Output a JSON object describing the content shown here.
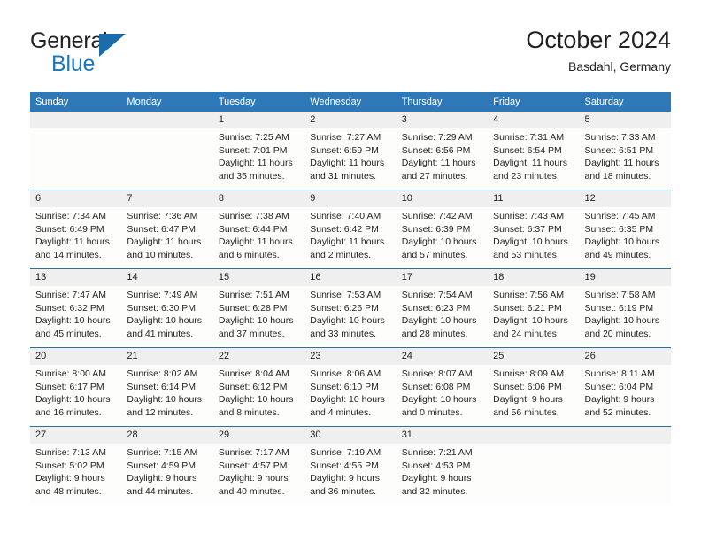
{
  "brand": {
    "line1": "General",
    "line2": "Blue",
    "logo_icon": "blue-triangle-icon",
    "accent_color": "#1b76bc"
  },
  "header": {
    "title": "October 2024",
    "subtitle": "Basdahl, Germany"
  },
  "theme": {
    "header_blue": "#2e78b7",
    "week_rule": "#2e6f9e",
    "daynum_band": "#efefef",
    "text": "#231f20"
  },
  "calendar": {
    "weekdays": [
      "Sunday",
      "Monday",
      "Tuesday",
      "Wednesday",
      "Thursday",
      "Friday",
      "Saturday"
    ],
    "weeks": [
      [
        {
          "day": "",
          "lines": []
        },
        {
          "day": "",
          "lines": []
        },
        {
          "day": "1",
          "lines": [
            "Sunrise: 7:25 AM",
            "Sunset: 7:01 PM",
            "Daylight: 11 hours",
            "and 35 minutes."
          ]
        },
        {
          "day": "2",
          "lines": [
            "Sunrise: 7:27 AM",
            "Sunset: 6:59 PM",
            "Daylight: 11 hours",
            "and 31 minutes."
          ]
        },
        {
          "day": "3",
          "lines": [
            "Sunrise: 7:29 AM",
            "Sunset: 6:56 PM",
            "Daylight: 11 hours",
            "and 27 minutes."
          ]
        },
        {
          "day": "4",
          "lines": [
            "Sunrise: 7:31 AM",
            "Sunset: 6:54 PM",
            "Daylight: 11 hours",
            "and 23 minutes."
          ]
        },
        {
          "day": "5",
          "lines": [
            "Sunrise: 7:33 AM",
            "Sunset: 6:51 PM",
            "Daylight: 11 hours",
            "and 18 minutes."
          ]
        }
      ],
      [
        {
          "day": "6",
          "lines": [
            "Sunrise: 7:34 AM",
            "Sunset: 6:49 PM",
            "Daylight: 11 hours",
            "and 14 minutes."
          ]
        },
        {
          "day": "7",
          "lines": [
            "Sunrise: 7:36 AM",
            "Sunset: 6:47 PM",
            "Daylight: 11 hours",
            "and 10 minutes."
          ]
        },
        {
          "day": "8",
          "lines": [
            "Sunrise: 7:38 AM",
            "Sunset: 6:44 PM",
            "Daylight: 11 hours",
            "and 6 minutes."
          ]
        },
        {
          "day": "9",
          "lines": [
            "Sunrise: 7:40 AM",
            "Sunset: 6:42 PM",
            "Daylight: 11 hours",
            "and 2 minutes."
          ]
        },
        {
          "day": "10",
          "lines": [
            "Sunrise: 7:42 AM",
            "Sunset: 6:39 PM",
            "Daylight: 10 hours",
            "and 57 minutes."
          ]
        },
        {
          "day": "11",
          "lines": [
            "Sunrise: 7:43 AM",
            "Sunset: 6:37 PM",
            "Daylight: 10 hours",
            "and 53 minutes."
          ]
        },
        {
          "day": "12",
          "lines": [
            "Sunrise: 7:45 AM",
            "Sunset: 6:35 PM",
            "Daylight: 10 hours",
            "and 49 minutes."
          ]
        }
      ],
      [
        {
          "day": "13",
          "lines": [
            "Sunrise: 7:47 AM",
            "Sunset: 6:32 PM",
            "Daylight: 10 hours",
            "and 45 minutes."
          ]
        },
        {
          "day": "14",
          "lines": [
            "Sunrise: 7:49 AM",
            "Sunset: 6:30 PM",
            "Daylight: 10 hours",
            "and 41 minutes."
          ]
        },
        {
          "day": "15",
          "lines": [
            "Sunrise: 7:51 AM",
            "Sunset: 6:28 PM",
            "Daylight: 10 hours",
            "and 37 minutes."
          ]
        },
        {
          "day": "16",
          "lines": [
            "Sunrise: 7:53 AM",
            "Sunset: 6:26 PM",
            "Daylight: 10 hours",
            "and 33 minutes."
          ]
        },
        {
          "day": "17",
          "lines": [
            "Sunrise: 7:54 AM",
            "Sunset: 6:23 PM",
            "Daylight: 10 hours",
            "and 28 minutes."
          ]
        },
        {
          "day": "18",
          "lines": [
            "Sunrise: 7:56 AM",
            "Sunset: 6:21 PM",
            "Daylight: 10 hours",
            "and 24 minutes."
          ]
        },
        {
          "day": "19",
          "lines": [
            "Sunrise: 7:58 AM",
            "Sunset: 6:19 PM",
            "Daylight: 10 hours",
            "and 20 minutes."
          ]
        }
      ],
      [
        {
          "day": "20",
          "lines": [
            "Sunrise: 8:00 AM",
            "Sunset: 6:17 PM",
            "Daylight: 10 hours",
            "and 16 minutes."
          ]
        },
        {
          "day": "21",
          "lines": [
            "Sunrise: 8:02 AM",
            "Sunset: 6:14 PM",
            "Daylight: 10 hours",
            "and 12 minutes."
          ]
        },
        {
          "day": "22",
          "lines": [
            "Sunrise: 8:04 AM",
            "Sunset: 6:12 PM",
            "Daylight: 10 hours",
            "and 8 minutes."
          ]
        },
        {
          "day": "23",
          "lines": [
            "Sunrise: 8:06 AM",
            "Sunset: 6:10 PM",
            "Daylight: 10 hours",
            "and 4 minutes."
          ]
        },
        {
          "day": "24",
          "lines": [
            "Sunrise: 8:07 AM",
            "Sunset: 6:08 PM",
            "Daylight: 10 hours",
            "and 0 minutes."
          ]
        },
        {
          "day": "25",
          "lines": [
            "Sunrise: 8:09 AM",
            "Sunset: 6:06 PM",
            "Daylight: 9 hours",
            "and 56 minutes."
          ]
        },
        {
          "day": "26",
          "lines": [
            "Sunrise: 8:11 AM",
            "Sunset: 6:04 PM",
            "Daylight: 9 hours",
            "and 52 minutes."
          ]
        }
      ],
      [
        {
          "day": "27",
          "lines": [
            "Sunrise: 7:13 AM",
            "Sunset: 5:02 PM",
            "Daylight: 9 hours",
            "and 48 minutes."
          ]
        },
        {
          "day": "28",
          "lines": [
            "Sunrise: 7:15 AM",
            "Sunset: 4:59 PM",
            "Daylight: 9 hours",
            "and 44 minutes."
          ]
        },
        {
          "day": "29",
          "lines": [
            "Sunrise: 7:17 AM",
            "Sunset: 4:57 PM",
            "Daylight: 9 hours",
            "and 40 minutes."
          ]
        },
        {
          "day": "30",
          "lines": [
            "Sunrise: 7:19 AM",
            "Sunset: 4:55 PM",
            "Daylight: 9 hours",
            "and 36 minutes."
          ]
        },
        {
          "day": "31",
          "lines": [
            "Sunrise: 7:21 AM",
            "Sunset: 4:53 PM",
            "Daylight: 9 hours",
            "and 32 minutes."
          ]
        },
        {
          "day": "",
          "lines": []
        },
        {
          "day": "",
          "lines": []
        }
      ]
    ]
  }
}
